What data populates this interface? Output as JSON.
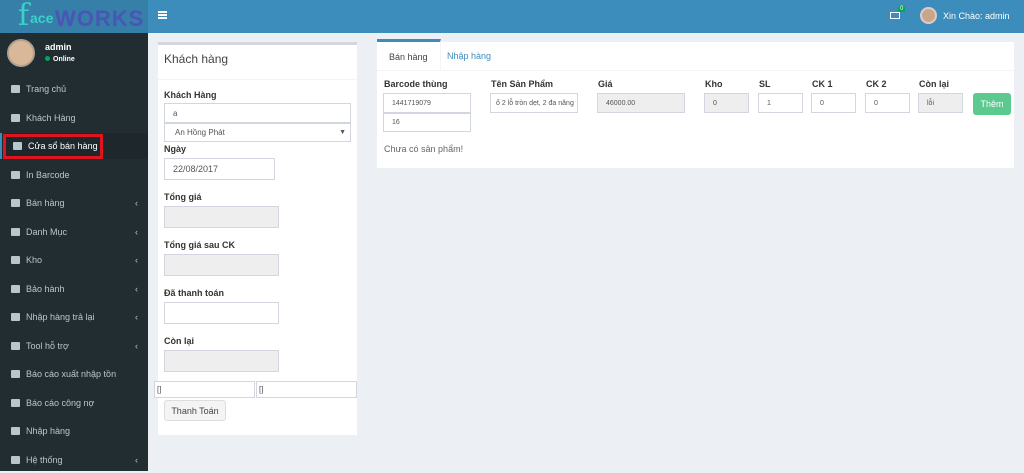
{
  "brand": {
    "logo_text": "faceWORKS"
  },
  "header": {
    "menu_icon": "hamburger-icon",
    "mail_icon": "envelope-icon",
    "mail_count": "0",
    "greeting": "Xin Chào: admin"
  },
  "user": {
    "name": "admin",
    "status": "Online"
  },
  "sidebar": {
    "items": [
      {
        "label": "Trang chủ",
        "icon": "home-icon",
        "chevron": false
      },
      {
        "label": "Khách Hàng",
        "icon": "users-icon",
        "chevron": false
      },
      {
        "label": "Cửa sổ bán hàng",
        "icon": "user-icon",
        "chevron": false,
        "active": true
      },
      {
        "label": "In Barcode",
        "icon": "barcode-icon",
        "chevron": false
      },
      {
        "label": "Bán hàng",
        "icon": "calculator-icon",
        "chevron": true
      },
      {
        "label": "Danh Mục",
        "icon": "book-icon",
        "chevron": true
      },
      {
        "label": "Kho",
        "icon": "cubes-icon",
        "chevron": true
      },
      {
        "label": "Bảo hành",
        "icon": "sort-icon",
        "chevron": true
      },
      {
        "label": "Nhập hàng trả lại",
        "icon": "recycle-icon",
        "chevron": true
      },
      {
        "label": "Tool hỗ trợ",
        "icon": "adjust-icon",
        "chevron": true
      },
      {
        "label": "Báo cáo xuất nhập tồn",
        "icon": "list-icon",
        "chevron": false
      },
      {
        "label": "Báo cáo công nợ",
        "icon": "book-icon",
        "chevron": false
      },
      {
        "label": "Nhập hàng",
        "icon": "book-icon",
        "chevron": false
      },
      {
        "label": "Hệ thống",
        "icon": "cogs-icon",
        "chevron": true
      }
    ]
  },
  "customer_panel": {
    "title": "Khách hàng",
    "customer_label": "Khách Hàng",
    "customer_search": "a",
    "customer_select": "An Hồng Phát",
    "date_label": "Ngày",
    "date_value": "22/08/2017",
    "total_label": "Tổng giá",
    "total_value": "",
    "total_after_label": "Tổng giá sau CK",
    "total_after_value": "",
    "paid_label": "Đã thanh toán",
    "paid_value": "",
    "remaining_label": "Còn lại",
    "remaining_value": "",
    "extra1": "[]",
    "extra2": "[]",
    "pay_button": "Thanh Toán"
  },
  "sales": {
    "tabs": [
      {
        "label": "Bán hàng",
        "active": true
      },
      {
        "label": "Nhập hàng",
        "active": false
      }
    ],
    "columns": {
      "barcode": "Barcode thùng",
      "name": "Tên Sản Phẩm",
      "price": "Giá",
      "stock": "Kho",
      "qty": "SL",
      "ck1": "CK 1",
      "ck2": "CK 2",
      "remaining": "Còn lại"
    },
    "values": {
      "barcode": "1441719079",
      "barcode2": "16",
      "name": "ổ 2 lỗ tròn dẹt, 2 đa năng",
      "price": "46000.00",
      "stock": "0",
      "qty": "1",
      "ck1": "0",
      "ck2": "0",
      "remaining": "lỗi"
    },
    "add_button": "Thêm",
    "empty_message": "Chưa có sản phẩm!"
  },
  "colors": {
    "header": "#3c8dbc",
    "sidebar": "#222d32",
    "add_button": "#5cc98f",
    "highlight": "#e0141e"
  }
}
